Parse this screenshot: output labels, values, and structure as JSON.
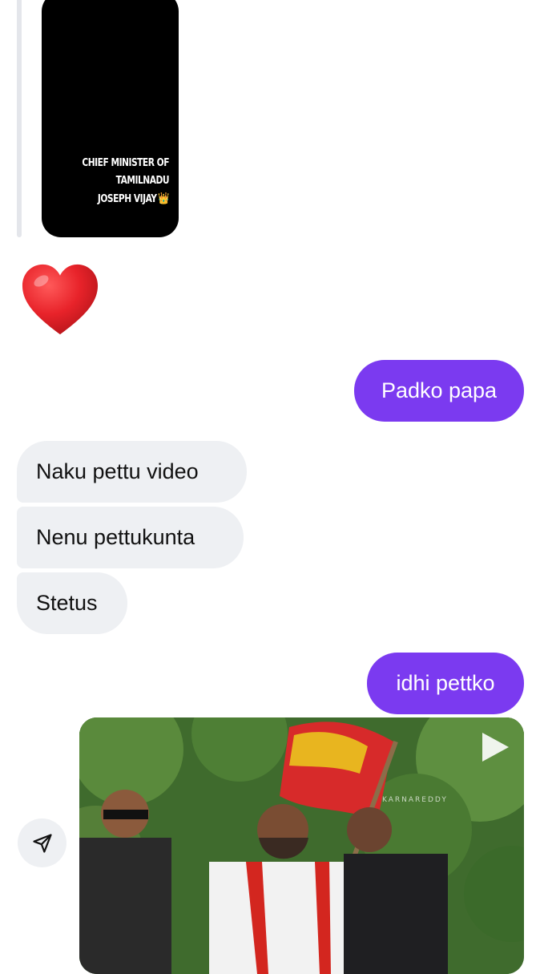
{
  "story": {
    "caption_line1": "CHIEF MINISTER OF",
    "caption_line2": "TAMILNADU",
    "caption_line3": "JOSEPH VIJAY",
    "crown_emoji": "👑"
  },
  "reaction": {
    "emoji": "heart-emoji",
    "color": "#e8232a"
  },
  "messages": [
    {
      "side": "outgoing",
      "text": "Padko papa"
    },
    {
      "side": "incoming",
      "text": "Naku pettu video"
    },
    {
      "side": "incoming",
      "text": "Nenu pettukunta"
    },
    {
      "side": "incoming",
      "text": "Stetus"
    },
    {
      "side": "outgoing",
      "text": "idhi pettko"
    }
  ],
  "shared_video": {
    "watermark": "KARNAREDDY",
    "play_icon": "play-icon",
    "share_icon": "send-icon"
  },
  "colors": {
    "outgoing_bubble": "#7b3af0",
    "incoming_bubble": "#eef0f3",
    "background": "#ffffff"
  }
}
